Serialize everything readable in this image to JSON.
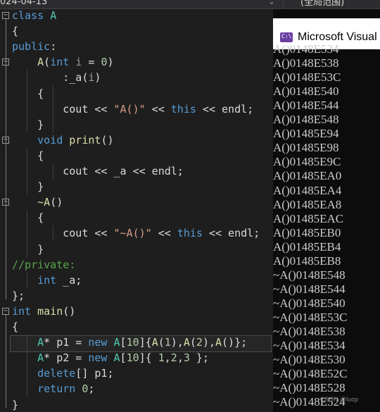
{
  "topbar": {
    "breadcrumb": "024-04-13",
    "dropdown_glyph": "⌄",
    "scope": "(全局范围)"
  },
  "editor": {
    "lines": [
      [
        [
          "kw",
          "class "
        ],
        [
          "cls",
          "A"
        ]
      ],
      [
        [
          "ident",
          "{"
        ]
      ],
      [
        [
          "kw",
          "public"
        ],
        [
          "ident",
          ":"
        ]
      ],
      [
        [
          "ident",
          "    "
        ],
        [
          "fn",
          "A"
        ],
        [
          "ident",
          "("
        ],
        [
          "kw",
          "int"
        ],
        [
          "ident",
          " "
        ],
        [
          "param",
          "i"
        ],
        [
          "ident",
          " = "
        ],
        [
          "num",
          "0"
        ],
        [
          "ident",
          ")"
        ]
      ],
      [
        [
          "ident",
          "        :"
        ],
        [
          "ident",
          "_a"
        ],
        [
          "ident",
          "("
        ],
        [
          "param",
          "i"
        ],
        [
          "ident",
          ")"
        ]
      ],
      [
        [
          "ident",
          "    {"
        ]
      ],
      [
        [
          "ident",
          "        cout << "
        ],
        [
          "str",
          "\"A()\""
        ],
        [
          "ident",
          " << "
        ],
        [
          "kw",
          "this"
        ],
        [
          "ident",
          " << endl;"
        ]
      ],
      [
        [
          "ident",
          "    }"
        ]
      ],
      [
        [
          "ident",
          "    "
        ],
        [
          "kw",
          "void"
        ],
        [
          "ident",
          " "
        ],
        [
          "fn",
          "print"
        ],
        [
          "ident",
          "()"
        ]
      ],
      [
        [
          "ident",
          "    {"
        ]
      ],
      [
        [
          "ident",
          "        cout << _a << endl;"
        ]
      ],
      [
        [
          "ident",
          "    }"
        ]
      ],
      [
        [
          "ident",
          "    "
        ],
        [
          "fn",
          "~A"
        ],
        [
          "ident",
          "()"
        ]
      ],
      [
        [
          "ident",
          "    {"
        ]
      ],
      [
        [
          "ident",
          "        cout << "
        ],
        [
          "str",
          "\"~A()\""
        ],
        [
          "ident",
          " << "
        ],
        [
          "kw",
          "this"
        ],
        [
          "ident",
          " << endl;"
        ]
      ],
      [
        [
          "ident",
          "    }"
        ]
      ],
      [
        [
          "cmt",
          "//private:"
        ]
      ],
      [
        [
          "ident",
          "    "
        ],
        [
          "kw",
          "int"
        ],
        [
          "ident",
          " _a;"
        ]
      ],
      [
        [
          "ident",
          "};"
        ]
      ],
      [
        [
          "kw",
          "int"
        ],
        [
          "ident",
          " "
        ],
        [
          "fn",
          "main"
        ],
        [
          "ident",
          "()"
        ]
      ],
      [
        [
          "ident",
          "{"
        ]
      ],
      [
        [
          "ident",
          "    "
        ],
        [
          "cls",
          "A"
        ],
        [
          "ident",
          "* p1 = "
        ],
        [
          "kw",
          "new"
        ],
        [
          "ident",
          " "
        ],
        [
          "cls",
          "A"
        ],
        [
          "ident",
          "["
        ],
        [
          "num",
          "10"
        ],
        [
          "ident",
          "]{"
        ],
        [
          "fn",
          "A"
        ],
        [
          "ident",
          "("
        ],
        [
          "num",
          "1"
        ],
        [
          "ident",
          "),"
        ],
        [
          "fn",
          "A"
        ],
        [
          "ident",
          "("
        ],
        [
          "num",
          "2"
        ],
        [
          "ident",
          "),"
        ],
        [
          "fn",
          "A"
        ],
        [
          "ident",
          "()};"
        ]
      ],
      [
        [
          "ident",
          "    "
        ],
        [
          "cls",
          "A"
        ],
        [
          "ident",
          "* p2 = "
        ],
        [
          "kw",
          "new"
        ],
        [
          "ident",
          " "
        ],
        [
          "cls",
          "A"
        ],
        [
          "ident",
          "["
        ],
        [
          "num",
          "10"
        ],
        [
          "ident",
          "]{ "
        ],
        [
          "num",
          "1"
        ],
        [
          "ident",
          ","
        ],
        [
          "num",
          "2"
        ],
        [
          "ident",
          ","
        ],
        [
          "num",
          "3"
        ],
        [
          "ident",
          " };"
        ]
      ],
      [
        [
          "ident",
          "    "
        ],
        [
          "kw",
          "delete"
        ],
        [
          "ident",
          "[] p1;"
        ]
      ],
      [
        [
          "ident",
          "    "
        ],
        [
          "kw",
          "return"
        ],
        [
          "ident",
          " "
        ],
        [
          "num",
          "0"
        ],
        [
          "ident",
          ";"
        ]
      ],
      [
        [
          "ident",
          "}"
        ]
      ]
    ],
    "fold_glyph": "−"
  },
  "console": {
    "title": "Microsoft Visual",
    "icon_text": "C:\\",
    "icon_color": "#6a3fa0",
    "output": [
      "A()0148E534",
      "A()0148E538",
      "A()0148E53C",
      "A()0148E540",
      "A()0148E544",
      "A()0148E548",
      "A()01485E94",
      "A()01485E98",
      "A()01485E9C",
      "A()01485EA0",
      "A()01485EA4",
      "A()01485EA8",
      "A()01485EAC",
      "A()01485EB0",
      "A()01485EB4",
      "A()01485EB8",
      "~A()0148E548",
      "~A()0148E544",
      "~A()0148E540",
      "~A()0148E53C",
      "~A()0148E538",
      "~A()0148E534",
      "~A()0148E530",
      "~A()0148E52C",
      "~A()0148E528",
      "~A()0148E524"
    ],
    "watermark": "CSDN @luop"
  },
  "colors": {
    "keyword": "#569cd6",
    "class": "#4ec9b0",
    "function": "#dcdcaa",
    "string": "#d69d85",
    "number": "#b5cea8",
    "comment": "#57a64a",
    "editor_bg": "#1e1e1e",
    "console_bg": "#0c0c0c"
  }
}
